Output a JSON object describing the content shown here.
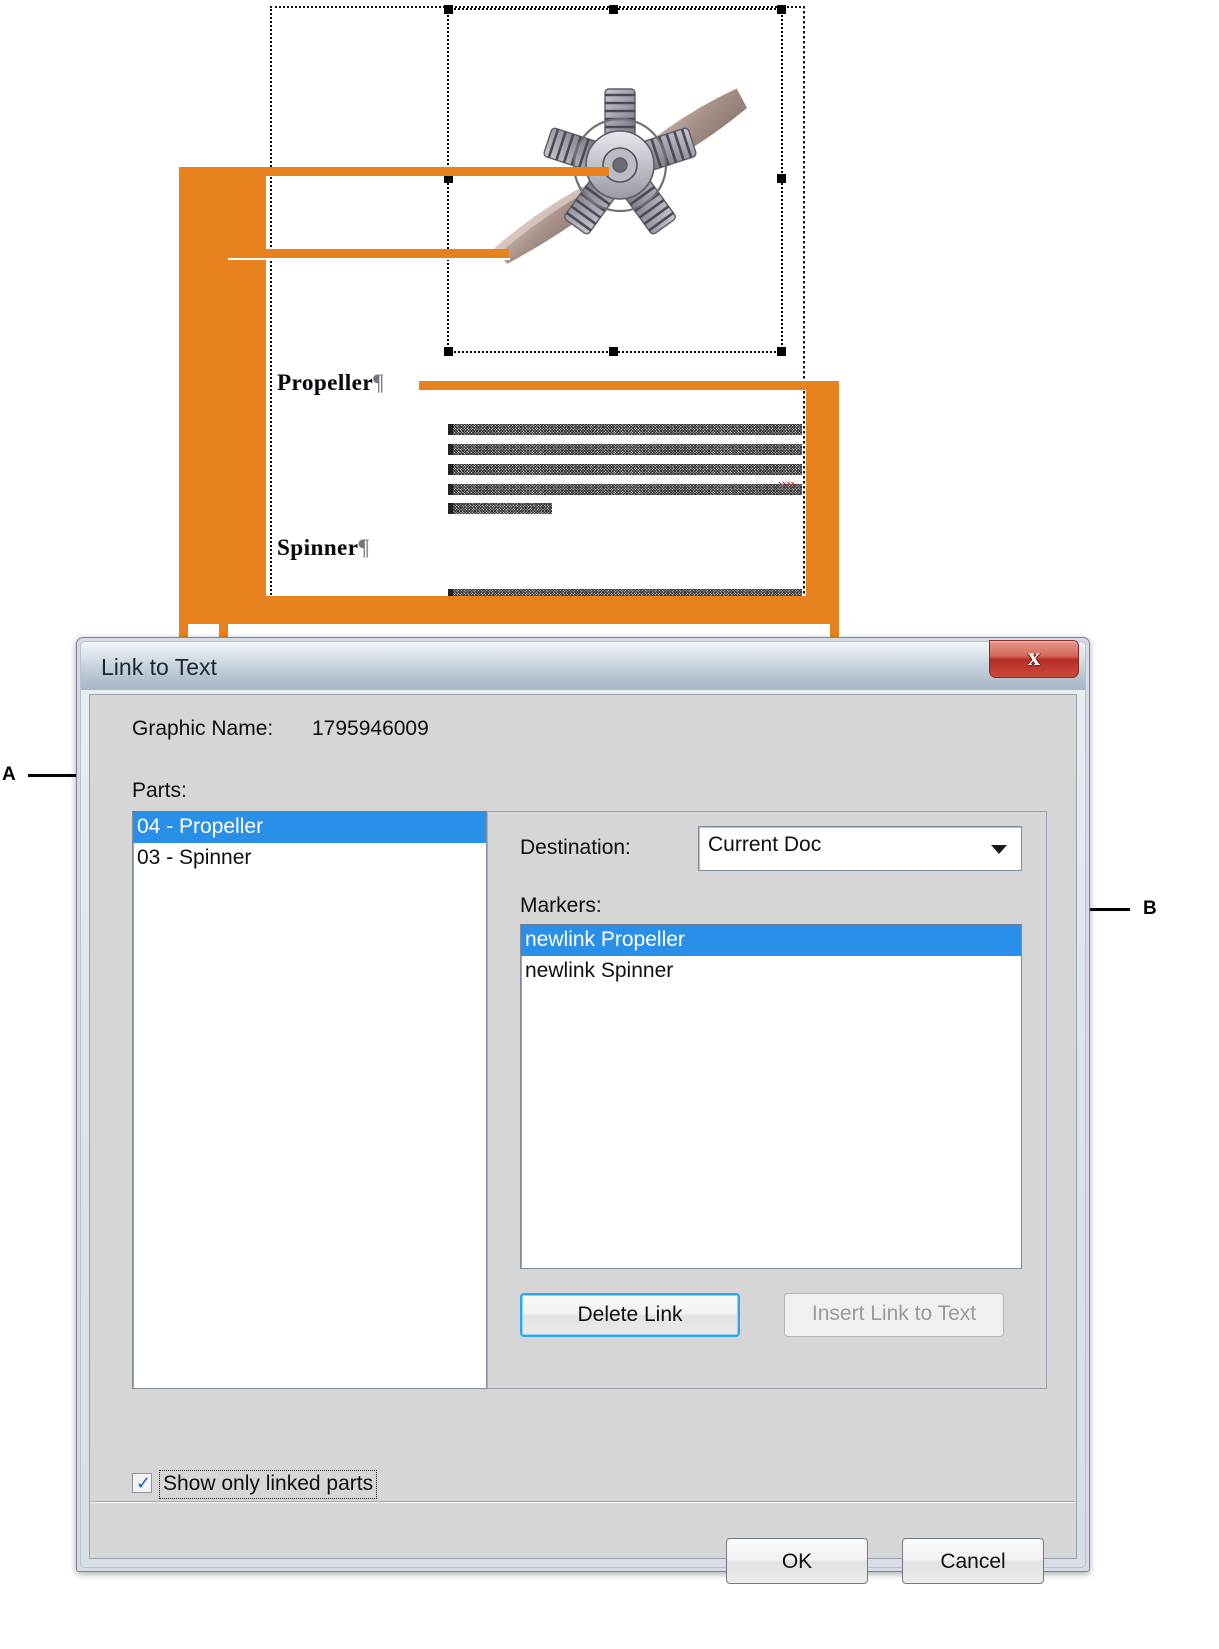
{
  "document": {
    "headings": [
      {
        "text": "Propeller",
        "pilcrow": "¶"
      },
      {
        "text": "Spinner",
        "pilcrow": "¶"
      }
    ],
    "graphic_alt": "propeller-and-engine-illustration"
  },
  "callouts": [
    {
      "id": "A",
      "label": "A",
      "points_to": "Parts:"
    },
    {
      "id": "B",
      "label": "B",
      "points_to": "Markers:"
    }
  ],
  "dialog": {
    "title": "Link to Text",
    "close_icon": "close-icon",
    "graphic_name_label": "Graphic Name:",
    "graphic_name_value": "1795946009",
    "parts_label": "Parts:",
    "parts": [
      {
        "label": "04 - Propeller",
        "selected": true
      },
      {
        "label": "03 - Spinner",
        "selected": false
      }
    ],
    "destination_label": "Destination:",
    "destination_value": "Current Doc",
    "destination_options": [
      "Current Doc"
    ],
    "markers_label": "Markers:",
    "markers": [
      {
        "label": "newlink Propeller",
        "selected": true
      },
      {
        "label": "newlink Spinner",
        "selected": false
      }
    ],
    "delete_link_label": "Delete Link",
    "insert_link_label": "Insert Link to Text",
    "insert_link_enabled": false,
    "show_only_linked_label": "Show only linked parts",
    "show_only_linked_checked": true,
    "check_glyph": "✓",
    "ok_label": "OK",
    "cancel_label": "Cancel"
  },
  "colors": {
    "callout_orange": "#E8821E",
    "selection_blue": "#2A8FE8",
    "dialog_face": "#D6D6D6",
    "titlebar_blue": "#B6C4D2",
    "close_red": "#B52D23",
    "focus_blue": "#2EA8E8"
  }
}
